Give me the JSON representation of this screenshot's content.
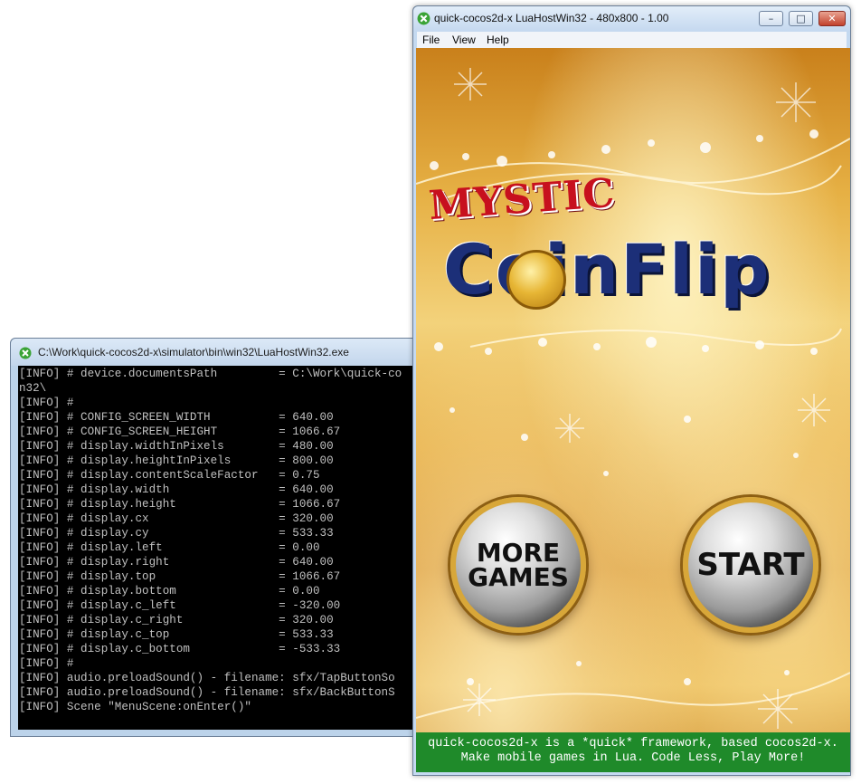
{
  "console": {
    "title": "C:\\Work\\quick-cocos2d-x\\simulator\\bin\\win32\\LuaHostWin32.exe",
    "lines": [
      "[INFO] # device.documentsPath         = C:\\Work\\quick-co",
      "n32\\",
      "[INFO] #",
      "[INFO] # CONFIG_SCREEN_WIDTH          = 640.00",
      "[INFO] # CONFIG_SCREEN_HEIGHT         = 1066.67",
      "[INFO] # display.widthInPixels        = 480.00",
      "[INFO] # display.heightInPixels       = 800.00",
      "[INFO] # display.contentScaleFactor   = 0.75",
      "[INFO] # display.width                = 640.00",
      "[INFO] # display.height               = 1066.67",
      "[INFO] # display.cx                   = 320.00",
      "[INFO] # display.cy                   = 533.33",
      "[INFO] # display.left                 = 0.00",
      "[INFO] # display.right                = 640.00",
      "[INFO] # display.top                  = 1066.67",
      "[INFO] # display.bottom               = 0.00",
      "[INFO] # display.c_left               = -320.00",
      "[INFO] # display.c_right              = 320.00",
      "[INFO] # display.c_top                = 533.33",
      "[INFO] # display.c_bottom             = -533.33",
      "[INFO] #",
      "[INFO] audio.preloadSound() - filename: sfx/TapButtonSo",
      "[INFO] audio.preloadSound() - filename: sfx/BackButtonS",
      "[INFO] Scene \"MenuScene:onEnter()\""
    ]
  },
  "simulator": {
    "title": "quick-cocos2d-x LuaHostWin32 - 480x800 - 1.00",
    "window_buttons": {
      "minimize": "–",
      "maximize": "□",
      "close": "✕"
    },
    "menu": {
      "file": "File",
      "view": "View",
      "help": "Help"
    }
  },
  "game": {
    "logo_top": "MYSTIC",
    "logo_main": "CoinFlip",
    "buttons": {
      "more_games": "MORE\nGAMES",
      "start": "START"
    },
    "footer": {
      "line1": "quick-cocos2d-x is a *quick* framework, based cocos2d-x.",
      "line2": "Make mobile games in Lua. Code Less, Play More!"
    }
  },
  "colors": {
    "console_bg": "#000000",
    "console_text": "#c0c0c0",
    "footer_bg": "#1f8a2a",
    "logo_blue": "#1c2f78",
    "logo_red": "#c7101e"
  }
}
